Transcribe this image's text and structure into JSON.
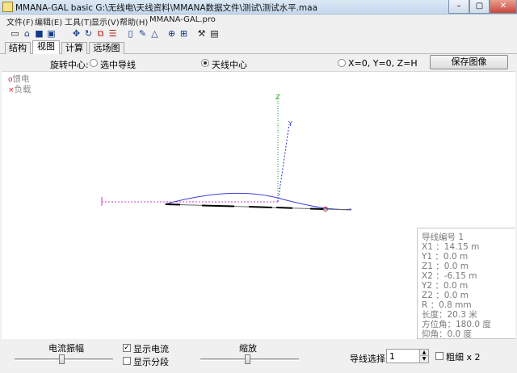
{
  "window": {
    "title": "MMANA-GAL basic G:\\无线电\\天线资料\\MMANA数据文件\\测试\\测试水平.maa",
    "minimize": "–",
    "maximize": "▢",
    "close": "✕"
  },
  "menu": {
    "items": [
      "文件(F)",
      "编辑(E)",
      "工具(T)",
      "显示(V)",
      "帮助(H)",
      "MMANA-GAL.pro"
    ]
  },
  "toolbar": {
    "icons": [
      "new-file-icon",
      "open-folder-icon",
      "save-disk-icon",
      "info-icon",
      "move-icon",
      "rotate-icon",
      "copy-icon",
      "wire-edit-icon",
      "page-icon",
      "pen-icon",
      "triangle-icon",
      "target-icon",
      "table-icon",
      "tools-icon",
      "calculator-icon"
    ]
  },
  "tabs": [
    {
      "label": "结构",
      "active": false
    },
    {
      "label": "视图",
      "active": true
    },
    {
      "label": "计算",
      "active": false
    },
    {
      "label": "远场图",
      "active": false
    }
  ],
  "rotation": {
    "label": "旋转中心:",
    "options": [
      {
        "label": "选中导线",
        "selected": false
      },
      {
        "label": "天线中心",
        "selected": true
      },
      {
        "label": "X=0, Y=0, Z=H",
        "selected": false
      }
    ],
    "save_button": "保存图像"
  },
  "legend": {
    "feed": "馈电",
    "load": "负载",
    "feed_mark": "o",
    "load_mark": "×"
  },
  "axes": {
    "z_label": "Z",
    "y_label": "Y",
    "x_label": "I"
  },
  "wire_info": {
    "title": "导线编号 1",
    "x1": "X1  ：14.15 m",
    "y1": "Y1  ：0.0 m",
    "z1": "Z1  ：0.0 m",
    "x2": "X2  ：-6.15 m",
    "y2": "Y2  ：0.0 m",
    "z2": "Z2  ：0.0 m",
    "r": "R   ：0.8 mm",
    "length": "长度：20.3 米",
    "azimuth": "方位角：180.0 度",
    "elevation": "仰角：0.0 度"
  },
  "bottom": {
    "current_amp_label": "电流振幅",
    "current_amp_level": 0.45,
    "show_current": {
      "label": "显示电流",
      "checked": true
    },
    "show_segments": {
      "label": "显示分段",
      "checked": false
    },
    "zoom_label": "缩放",
    "zoom_level": 0.45,
    "wire_select_label": "导线选择",
    "wire_select_value": "1",
    "bold_x2": {
      "label": "粗细 x 2",
      "checked": false
    }
  },
  "colors": {
    "current_curve": "#3b3bd6",
    "z_axis": "#1a9a1a",
    "y_axis": "#2a2ad6",
    "x_axis": "#d23ad2",
    "wire": "#000000",
    "feed_marker": "#d22222"
  }
}
